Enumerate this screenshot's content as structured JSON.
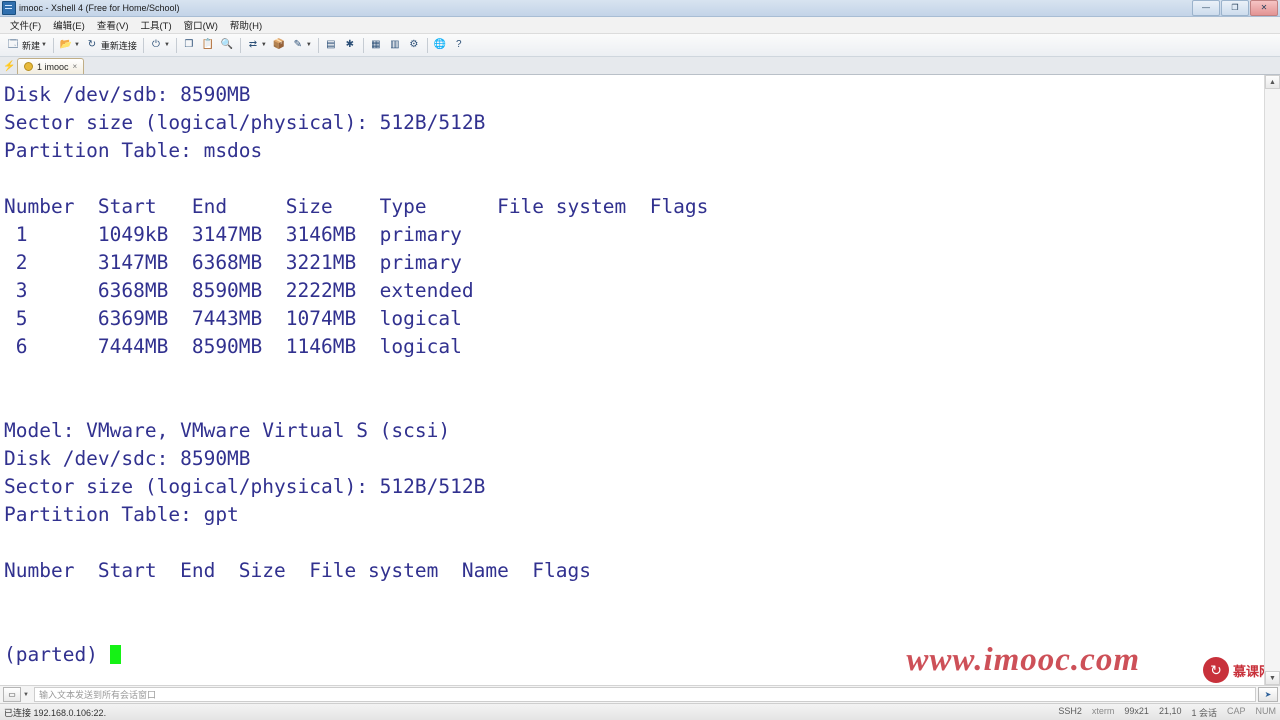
{
  "window": {
    "title": "imooc - Xshell 4 (Free for Home/School)",
    "app_icon": "terminal-icon",
    "buttons": {
      "minimize": "—",
      "maximize": "❐",
      "close": "✕"
    }
  },
  "menubar": {
    "items": [
      {
        "label": "文件(F)",
        "name": "menu-file"
      },
      {
        "label": "编辑(E)",
        "name": "menu-edit"
      },
      {
        "label": "查看(V)",
        "name": "menu-view"
      },
      {
        "label": "工具(T)",
        "name": "menu-tools"
      },
      {
        "label": "窗口(W)",
        "name": "menu-window"
      },
      {
        "label": "帮助(H)",
        "name": "menu-help"
      }
    ]
  },
  "toolbar": {
    "new_label": "新建",
    "reconnect_label": "重新连接",
    "items": [
      {
        "name": "new-session-button",
        "glyph": "🗔"
      },
      {
        "name": "open-session-button",
        "glyph": "📂"
      },
      {
        "name": "reconnect-button",
        "glyph": "↻"
      },
      {
        "name": "disconnect-button",
        "glyph": "⏻"
      },
      {
        "name": "copy-button",
        "glyph": "❐"
      },
      {
        "name": "paste-button",
        "glyph": "📋"
      },
      {
        "name": "find-button",
        "glyph": "🔍"
      },
      {
        "name": "transfer-button",
        "glyph": "⇄"
      },
      {
        "name": "ftp-button",
        "glyph": "📦"
      },
      {
        "name": "compose-button",
        "glyph": "✎"
      },
      {
        "name": "log-button",
        "glyph": "▤"
      },
      {
        "name": "highlight-button",
        "glyph": "✱"
      },
      {
        "name": "tile-button",
        "glyph": "▦"
      },
      {
        "name": "arrange-button",
        "glyph": "▥"
      },
      {
        "name": "properties-button",
        "glyph": "⚙"
      },
      {
        "name": "globe-button",
        "glyph": "🌐"
      },
      {
        "name": "help-button",
        "glyph": "?"
      }
    ]
  },
  "tabs": {
    "left_icon": "lightning-icon",
    "items": [
      {
        "label": "1 imooc",
        "name": "tab-session-imooc",
        "close": "×"
      }
    ]
  },
  "terminal": {
    "lines": [
      "Disk /dev/sdb: 8590MB",
      "Sector size (logical/physical): 512B/512B",
      "Partition Table: msdos",
      "",
      "Number  Start   End     Size    Type      File system  Flags",
      " 1      1049kB  3147MB  3146MB  primary",
      " 2      3147MB  6368MB  3221MB  primary",
      " 3      6368MB  8590MB  2222MB  extended",
      " 5      6369MB  7443MB  1074MB  logical",
      " 6      7444MB  8590MB  1146MB  logical",
      "",
      "",
      "Model: VMware, VMware Virtual S (scsi)",
      "Disk /dev/sdc: 8590MB",
      "Sector size (logical/physical): 512B/512B",
      "Partition Table: gpt",
      "",
      "Number  Start  End  Size  File system  Name  Flags",
      "",
      ""
    ],
    "prompt": "(parted) ",
    "text_color": "#31318f",
    "cursor_color": "#15f215"
  },
  "watermarks": {
    "site": "www.imooc.com",
    "logo_text": "慕课网",
    "logo_glyph": "↻"
  },
  "input_strip": {
    "placeholder": "输入文本发送到所有会话窗口",
    "send_icon": "send-icon",
    "target_icon": "window-target-icon"
  },
  "statusbar": {
    "connection": "已连接 192.168.0.106:22.",
    "protocol": "SSH2",
    "cipher": "xterm",
    "size": "99x21",
    "cursor": "21,10",
    "sessions": "1 会话",
    "caps": "CAP",
    "num": "NUM"
  }
}
